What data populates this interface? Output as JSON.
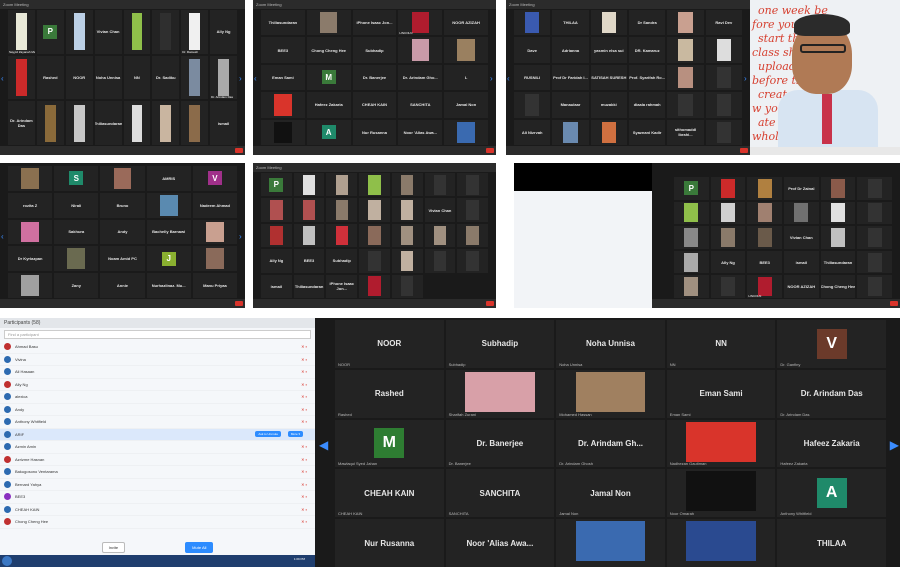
{
  "shots": [
    {
      "id": "s1",
      "title": "Zoom Meeting",
      "cols": 8,
      "tiles": [
        {
          "label": "",
          "name": "Sayyid Zayanah Malihan",
          "color": "#e9e9d8"
        },
        {
          "label": "P",
          "name": "",
          "avatar": "#3a7a3a"
        },
        {
          "label": "",
          "name": "",
          "color": "#bcd0e6"
        },
        {
          "label": "Vivian Chan",
          "name": ""
        },
        {
          "label": "",
          "name": "",
          "color": "#8fbf4a"
        },
        {
          "label": "",
          "name": "",
          "color": "#2f2f2f"
        },
        {
          "label": "",
          "name": "Dr. Ramesh",
          "color": "#f0f0f0"
        },
        {
          "label": "Ally Ng",
          "name": ""
        },
        {
          "label": "",
          "name": "",
          "color": "#cc2a2a"
        },
        {
          "label": "Rashed",
          "name": ""
        },
        {
          "label": "NOOR",
          "name": ""
        },
        {
          "label": "Noha Unnisa",
          "name": ""
        },
        {
          "label": "NN",
          "name": ""
        },
        {
          "label": "Dr. Sadiku",
          "name": ""
        },
        {
          "label": "",
          "name": "",
          "color": "#7b8ba0"
        },
        {
          "label": "",
          "name": "Dr. Arindam Das",
          "color": "#aaa"
        },
        {
          "label": "Dr. Arindam Das",
          "name": ""
        },
        {
          "label": "",
          "name": "",
          "color": "#8a6a3a"
        },
        {
          "label": "",
          "name": "",
          "color": "#c8c8c8"
        },
        {
          "label": "Thiliasundaran",
          "name": ""
        },
        {
          "label": "",
          "name": "",
          "color": "#ddd"
        },
        {
          "label": "",
          "name": "",
          "color": "#c9b5a0"
        },
        {
          "label": "",
          "name": "",
          "color": "#8b6b4a"
        },
        {
          "label": "ismail",
          "name": ""
        }
      ]
    },
    {
      "id": "s2",
      "title": "Zoom Meeting",
      "cols": 5,
      "tiles": [
        {
          "label": "Thiliasundaran",
          "name": ""
        },
        {
          "label": "",
          "name": "",
          "color": "#8b7b6b"
        },
        {
          "label": "iPhone Isaac Jon...",
          "name": ""
        },
        {
          "label": "",
          "name": "LINCOLN",
          "color": "#b01c2e"
        },
        {
          "label": "NOOR AZIZAH",
          "name": ""
        },
        {
          "label": "BEE3",
          "name": ""
        },
        {
          "label": "Chong Cheng Hee",
          "name": ""
        },
        {
          "label": "Subhadip",
          "name": ""
        },
        {
          "label": "",
          "name": "",
          "color": "#c99aa8"
        },
        {
          "label": "",
          "name": "",
          "color": "#9a8060"
        },
        {
          "label": "Eman Sami",
          "name": ""
        },
        {
          "label": "M",
          "name": "",
          "avatar": "#3a7a3a"
        },
        {
          "label": "Dr. Banerjee",
          "name": ""
        },
        {
          "label": "Dr. Arindam Gho...",
          "name": ""
        },
        {
          "label": "L",
          "name": ""
        },
        {
          "label": "",
          "name": "",
          "color": "#d9342b"
        },
        {
          "label": "Hafeez Zakaria",
          "name": ""
        },
        {
          "label": "CHEAH KAIN",
          "name": ""
        },
        {
          "label": "SANCHITA",
          "name": ""
        },
        {
          "label": "Jamal Non",
          "name": ""
        },
        {
          "label": "",
          "name": "",
          "color": "#111"
        },
        {
          "label": "A",
          "name": "",
          "avatar": "#1f8a6a"
        },
        {
          "label": "Nur Rusanna",
          "name": ""
        },
        {
          "label": "Noor 'Alias Awa...",
          "name": ""
        },
        {
          "label": "",
          "name": "",
          "color": "#3a6ab0"
        }
      ]
    },
    {
      "id": "s3",
      "title": "Zoom Meeting",
      "cols": 6,
      "tiles": [
        {
          "label": "",
          "name": "",
          "color": "#3a5ab0"
        },
        {
          "label": "THILAA",
          "name": ""
        },
        {
          "label": "",
          "name": "",
          "color": "#e0d8c8"
        },
        {
          "label": "Dr Sandra",
          "name": ""
        },
        {
          "label": "",
          "name": "",
          "color": "#c9a090"
        },
        {
          "label": "Ravi Dev",
          "name": ""
        },
        {
          "label": "Dave",
          "name": ""
        },
        {
          "label": "Adrianna",
          "name": ""
        },
        {
          "label": "yasmin elsa sui",
          "name": ""
        },
        {
          "label": "DR. Kamaruz",
          "name": ""
        },
        {
          "label": "",
          "name": "",
          "color": "#c9b9a0"
        },
        {
          "label": "",
          "name": "",
          "color": "#ddd"
        },
        {
          "label": "RUSNILI",
          "name": ""
        },
        {
          "label": "Prof Dr Faridah I...",
          "name": ""
        },
        {
          "label": "SATISAH SURESH",
          "name": ""
        },
        {
          "label": "Prof. Syarifah Ro...",
          "name": ""
        },
        {
          "label": "",
          "name": "",
          "color": "#b89080"
        },
        {
          "label": "",
          "name": "",
          "color": "#333"
        },
        {
          "label": "",
          "name": "",
          "color": "#333"
        },
        {
          "label": "Manaulaar",
          "name": ""
        },
        {
          "label": "muzakki",
          "name": ""
        },
        {
          "label": "diaala rahmah",
          "name": ""
        },
        {
          "label": "",
          "name": "",
          "color": "#333"
        },
        {
          "label": "",
          "name": "",
          "color": "#333"
        },
        {
          "label": "Ali Nizrvah",
          "name": ""
        },
        {
          "label": "",
          "name": "",
          "color": "#6a8ab0"
        },
        {
          "label": "",
          "name": "",
          "color": "#d07040"
        },
        {
          "label": "Syaznani Kadir",
          "name": ""
        },
        {
          "label": "sithomaddl Ibrahi...",
          "name": ""
        },
        {
          "label": "",
          "name": "",
          "color": "#333"
        }
      ]
    },
    {
      "id": "s4",
      "title": "",
      "cols": 5,
      "tiles": [
        {
          "label": "",
          "name": "",
          "color": "#8a7050"
        },
        {
          "label": "S",
          "name": "",
          "avatar": "#1f8a6a"
        },
        {
          "label": "",
          "name": "",
          "color": "#9a6a5a"
        },
        {
          "label": "AMRIS",
          "name": ""
        },
        {
          "label": "V",
          "name": "",
          "avatar": "#a0308a"
        },
        {
          "label": "rozita Z",
          "name": ""
        },
        {
          "label": "Nirali",
          "name": ""
        },
        {
          "label": "Bruno",
          "name": ""
        },
        {
          "label": "",
          "name": "",
          "color": "#5a8ab0"
        },
        {
          "label": "Nadeem Ahmad",
          "name": ""
        },
        {
          "label": "",
          "name": "",
          "color": "#d070a0"
        },
        {
          "label": "Sakhura",
          "name": ""
        },
        {
          "label": "Andy",
          "name": ""
        },
        {
          "label": "Bachelly Barnawi",
          "name": ""
        },
        {
          "label": "",
          "name": "",
          "color": "#c9a090"
        },
        {
          "label": "Dr Kyriazpan",
          "name": ""
        },
        {
          "label": "",
          "name": "",
          "color": "#6a6a50"
        },
        {
          "label": "Noam Amid PC",
          "name": ""
        },
        {
          "label": "J",
          "name": "",
          "avatar": "#8ab030"
        },
        {
          "label": "",
          "name": "",
          "color": "#8a6a5a"
        },
        {
          "label": "",
          "name": "",
          "color": "#a0a0a0"
        },
        {
          "label": "Zany",
          "name": ""
        },
        {
          "label": "Annie",
          "name": ""
        },
        {
          "label": "Nurhazlinaz. Mu...",
          "name": ""
        },
        {
          "label": "Manu Priyaa",
          "name": ""
        }
      ]
    },
    {
      "id": "s5",
      "title": "Zoom Meeting",
      "cols": 7,
      "tiles": [
        {
          "label": "P",
          "name": "",
          "avatar": "#3a7a3a"
        },
        {
          "label": "",
          "name": "",
          "color": "#e0e0e0"
        },
        {
          "label": "",
          "name": "",
          "color": "#b0a090"
        },
        {
          "label": "",
          "name": "",
          "color": "#8fbf4a"
        },
        {
          "label": "",
          "name": "",
          "color": "#8a7a6a"
        },
        {
          "label": "",
          "name": "",
          "color": "#333"
        },
        {
          "label": "",
          "name": "",
          "color": "#333"
        },
        {
          "label": "",
          "name": "",
          "color": "#b05050"
        },
        {
          "label": "",
          "name": "",
          "color": "#b05050"
        },
        {
          "label": "",
          "name": "",
          "color": "#8a7a6a"
        },
        {
          "label": "",
          "name": "",
          "color": "#c0b0a0"
        },
        {
          "label": "",
          "name": "",
          "color": "#c0b0a0"
        },
        {
          "label": "Vivian Chan",
          "name": ""
        },
        {
          "label": "",
          "name": "",
          "color": "#333"
        },
        {
          "label": "",
          "name": "",
          "color": "#b03030"
        },
        {
          "label": "",
          "name": "",
          "color": "#c0c0c0"
        },
        {
          "label": "",
          "name": "",
          "color": "#d0303a"
        },
        {
          "label": "",
          "name": "",
          "color": "#8a6a5a"
        },
        {
          "label": "",
          "name": "",
          "color": "#a09080"
        },
        {
          "label": "",
          "name": "",
          "color": "#a09080"
        },
        {
          "label": "",
          "name": "",
          "color": "#8a7a6a"
        },
        {
          "label": "Ally Ng",
          "name": ""
        },
        {
          "label": "BEE3",
          "name": ""
        },
        {
          "label": "Subhadip",
          "name": ""
        },
        {
          "label": "",
          "name": "",
          "color": "#333"
        },
        {
          "label": "",
          "name": "",
          "color": "#c0b0a0"
        },
        {
          "label": "",
          "name": "",
          "color": "#333"
        },
        {
          "label": "",
          "name": "",
          "color": "#333"
        },
        {
          "label": "ismail",
          "name": ""
        },
        {
          "label": "Thiliasundaran",
          "name": ""
        },
        {
          "label": "iPhone Isaac Jon...",
          "name": ""
        },
        {
          "label": "",
          "name": "",
          "color": "#b01c2e"
        },
        {
          "label": "",
          "name": "",
          "color": "#333"
        }
      ]
    },
    {
      "id": "s6",
      "title": "",
      "cols": 6,
      "tiles": [
        {
          "label": "P",
          "name": "",
          "avatar": "#3a7a3a"
        },
        {
          "label": "",
          "name": "",
          "color": "#cc2a2a"
        },
        {
          "label": "",
          "name": "",
          "color": "#b08040"
        },
        {
          "label": "Prof Dr Zainal",
          "name": ""
        },
        {
          "label": "",
          "name": "",
          "color": "#8a5a4a"
        },
        {
          "label": "",
          "name": "",
          "color": "#333"
        },
        {
          "label": "",
          "name": "",
          "color": "#8fbf4a"
        },
        {
          "label": "",
          "name": "",
          "color": "#d0d0d0"
        },
        {
          "label": "",
          "name": "",
          "color": "#a08070"
        },
        {
          "label": "",
          "name": "",
          "color": "#707070"
        },
        {
          "label": "",
          "name": "",
          "color": "#e0e0e0"
        },
        {
          "label": "",
          "name": "",
          "color": "#333"
        },
        {
          "label": "",
          "name": "",
          "color": "#888"
        },
        {
          "label": "",
          "name": "",
          "color": "#8a7a6a"
        },
        {
          "label": "",
          "name": "",
          "color": "#6a5a4a"
        },
        {
          "label": "Vivian Chan",
          "name": ""
        },
        {
          "label": "",
          "name": "",
          "color": "#c0c0c0"
        },
        {
          "label": "",
          "name": "",
          "color": "#333"
        },
        {
          "label": "",
          "name": "",
          "color": "#aaa"
        },
        {
          "label": "Ally Ng",
          "name": ""
        },
        {
          "label": "BEE3",
          "name": ""
        },
        {
          "label": "ismail",
          "name": ""
        },
        {
          "label": "Thiliasundaran",
          "name": ""
        },
        {
          "label": "",
          "name": "",
          "color": "#333"
        },
        {
          "label": "",
          "name": "",
          "color": "#a09080"
        },
        {
          "label": "",
          "name": "",
          "color": "#333"
        },
        {
          "label": "",
          "name": "LINCOLN",
          "color": "#b01c2e"
        },
        {
          "label": "NOOR AZIZAH",
          "name": ""
        },
        {
          "label": "Chong Cheng Hee",
          "name": ""
        },
        {
          "label": "",
          "name": "",
          "color": "#333"
        }
      ]
    }
  ],
  "board": {
    "lines": [
      "one week be",
      "fore you",
      "start the",
      "class show",
      "uploaded in L",
      "before the cl",
      "create group",
      "w you assign",
      "ate ur dates",
      "whole class"
    ]
  },
  "participants": {
    "title": "Participants (58)",
    "search": "Find a participant",
    "rows": [
      {
        "name": "Ahmad Basu",
        "color": "#c03030"
      },
      {
        "name": "Vivina",
        "color": "#2d6ab0"
      },
      {
        "name": "Ali Hasaan",
        "color": "#2d6ab0"
      },
      {
        "name": "Ally Ng",
        "color": "#c03030"
      },
      {
        "name": "alexica",
        "color": "#2d6ab0"
      },
      {
        "name": "Andy",
        "color": "#2d6ab0"
      },
      {
        "name": "Anthony Whitfield",
        "color": "#2d6ab0"
      },
      {
        "name": "ARIF",
        "color": "#2d6ab0",
        "selected": true
      },
      {
        "name": "Azmin Amin",
        "color": "#2d6ab0"
      },
      {
        "name": "Azrizme Hasnan",
        "color": "#c03030"
      },
      {
        "name": "Bakugosono Ventarama",
        "color": "#2d6ab0"
      },
      {
        "name": "Bernard Yahya",
        "color": "#2d6ab0"
      },
      {
        "name": "BEE3",
        "color": "#8a30c0"
      },
      {
        "name": "CHEAH KAIN",
        "color": "#2d6ab0"
      },
      {
        "name": "Chong Cheng Hee",
        "color": "#c03030"
      }
    ],
    "ask_unmute": "Ask to Unmute",
    "more": "More ▾",
    "footer_invite": "Invite",
    "footer_mute": "Mute All",
    "clock": "1:09 PM"
  },
  "big_grid": {
    "tiles": [
      {
        "label": "NOOR",
        "name": "NOOR"
      },
      {
        "label": "Subhadip",
        "name": "Subhadip"
      },
      {
        "label": "Noha Unnisa",
        "name": "Noha Unnisa"
      },
      {
        "label": "NN",
        "name": "NN"
      },
      {
        "label": "V",
        "name": "Dr. Ganfiny",
        "avatar": "#6b3a2a"
      },
      {
        "label": "Rashed",
        "name": "Rashed"
      },
      {
        "label": "",
        "name": "Sharifah Zurani",
        "color": "#d8a0a8"
      },
      {
        "label": "",
        "name": "Mohamed Hassan",
        "color": "#a08060"
      },
      {
        "label": "Eman Sami",
        "name": "Eman Sami"
      },
      {
        "label": "Dr. Arindam Das",
        "name": "Dr. Arindam Das"
      },
      {
        "label": "M",
        "name": "Mawlaqui Syed Jahan",
        "avatar": "#2e7d32"
      },
      {
        "label": "Dr. Banerjee",
        "name": "Dr. Banerjee"
      },
      {
        "label": "Dr. Arindam Gh...",
        "name": "Dr. Arindam Ghosh"
      },
      {
        "label": "",
        "name": "Nadhezan Gautiman",
        "color": "#d9342b"
      },
      {
        "label": "Hafeez Zakaria",
        "name": "Hafeez Zakaria"
      },
      {
        "label": "CHEAH KAIN",
        "name": "CHEAH KAIN"
      },
      {
        "label": "SANCHITA",
        "name": "SANCHITA"
      },
      {
        "label": "Jamal Non",
        "name": "Jamal Non"
      },
      {
        "label": "",
        "name": "Noor Omarah",
        "color": "#111111"
      },
      {
        "label": "A",
        "name": "Anthony Whitfield",
        "avatar": "#1f8a6a"
      },
      {
        "label": "Nur Rusanna",
        "name": ""
      },
      {
        "label": "Noor 'Alias Awa...",
        "name": ""
      },
      {
        "label": "",
        "name": "",
        "color": "#3a6ab0"
      },
      {
        "label": "",
        "name": "",
        "color": "#2a4a90"
      },
      {
        "label": "THILAA",
        "name": ""
      }
    ]
  }
}
